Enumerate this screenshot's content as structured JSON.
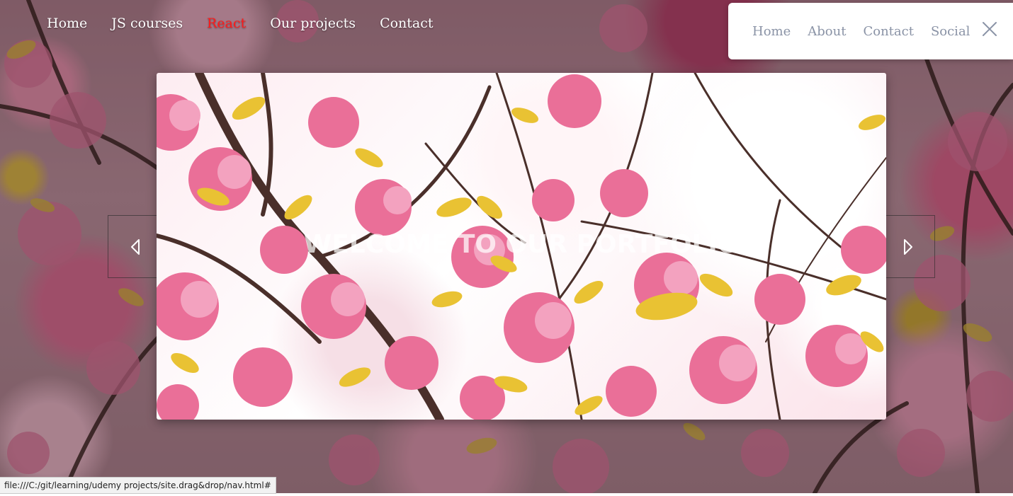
{
  "nav": {
    "items": [
      {
        "label": "Home",
        "active": false
      },
      {
        "label": "JS courses",
        "active": false
      },
      {
        "label": "React",
        "active": true
      },
      {
        "label": "Our projects",
        "active": false
      },
      {
        "label": "Contact",
        "active": false
      }
    ],
    "active_color": "#ff1a1a"
  },
  "side_menu": {
    "items": [
      {
        "label": "Home"
      },
      {
        "label": "About"
      },
      {
        "label": "Contact"
      },
      {
        "label": "Social"
      }
    ],
    "close_icon": "close-icon"
  },
  "slider": {
    "title": "WELCOME TO OUR PORTFOLIO",
    "prev_icon": "chevron-left-icon",
    "next_icon": "chevron-right-icon"
  },
  "status_bar": {
    "url": "file:///C:/git/learning/udemy projects/site.drag&drop/nav.html#"
  },
  "colors": {
    "blossom_pink": "#e9739b",
    "leaf_yellow": "#e8c233",
    "branch_brown": "#4a2f2a"
  }
}
